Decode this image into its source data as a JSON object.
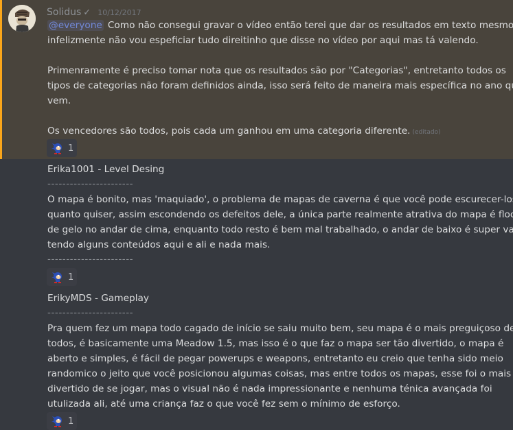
{
  "message": {
    "username": "Solidus",
    "verified_mark": "✓",
    "timestamp": "10/12/2017",
    "mention": "@everyone",
    "lines_first": [
      "Como não consegui gravar o vídeo então terei que dar os resultados em texto mesmo,",
      "infelizmente não vou espeficiar tudo direitinho que disse no vídeo por aqui mas tá valendo.",
      "Primenramente é preciso tomar nota que os resultados são por \"Categorias\", entretanto todos os",
      "tipos de categorias não foram definidos ainda, isso será feito de maneira mais específica no ano que",
      "vem.",
      "Os vencedores são todos, pois cada um ganhou em uma categoria diferente."
    ],
    "edited_label": "(editado)",
    "reaction_count": "1"
  },
  "entries": [
    {
      "title": "Erika1001 - Level Desing",
      "divider": "-----------------------",
      "lines": [
        "O mapa é bonito, mas 'maquiado', o problema de mapas de caverna é que você pode escurecer-los o",
        "quanto quiser, assim escondendo os defeitos dele, a única parte realmente atrativa do mapa é floco",
        "de gelo no andar de cima, enquanto todo resto é bem mal trabalhado, o andar de baixo é super vazio,",
        "tendo alguns conteúdos aqui e ali e nada mais."
      ],
      "divider_end": "-----------------------",
      "reaction_count": "1"
    },
    {
      "title": "ErikyMDS - Gameplay",
      "divider": "-----------------------",
      "lines": [
        "Pra quem fez um mapa todo cagado de início se saiu muito bem, seu mapa é o mais preguiçoso de",
        "todos, é basicamente uma Meadow 1.5, mas isso é o que faz o mapa ser tão divertido, o mapa é",
        "aberto e simples, é fácil de pegar powerups e weapons, entretanto eu creio que tenha sido meio",
        "randomico o jeito que você posicionou algumas coisas, mas entre todos os mapas, esse foi o mais",
        "divertido de se jogar, mas o visual não é nada impressionante e nenhuma ténica avançada foi",
        "utulizada ali, até uma criança faz o que você fez sem o mínimo de esforço."
      ],
      "reaction_count": "1"
    }
  ],
  "colors": {
    "background": "#36393f",
    "mention_highlight": "#49443c",
    "mention_bar": "#faa61a",
    "text": "#dcddde",
    "mention_text": "#7289da"
  },
  "icons": {
    "reaction_emoji": "sonic-emoji-icon",
    "avatar": "user-avatar"
  }
}
